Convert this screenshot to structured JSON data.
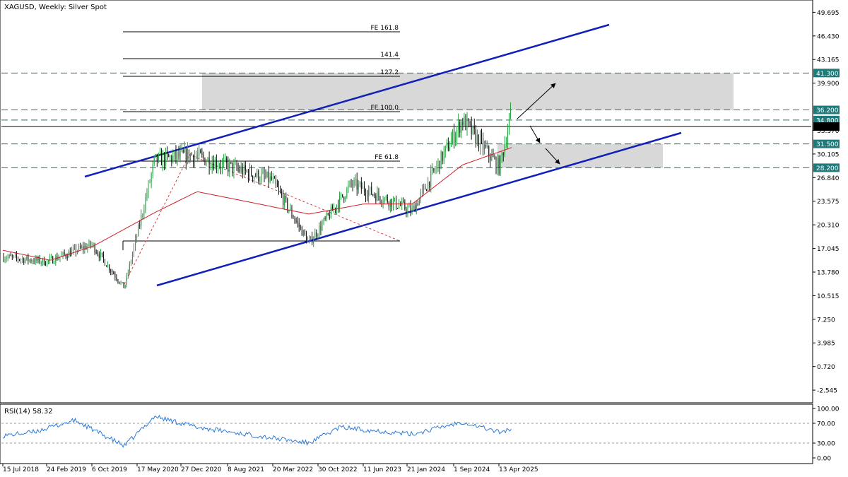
{
  "header": {
    "symbol_title": "XAGUSD, Weekly:  Silver Spot"
  },
  "rsi_panel": {
    "title": "RSI(14) 58.32",
    "value": 58.32,
    "levels": [
      70,
      30
    ],
    "axis_ticks": [
      "100.00",
      "70.00",
      "30.00",
      "0.00"
    ]
  },
  "price_axis_ticks": [
    "49.695",
    "46.430",
    "43.165",
    "39.900",
    "33.370",
    "30.105",
    "26.840",
    "23.575",
    "20.310",
    "17.045",
    "13.780",
    "10.515",
    "7.250",
    "3.985",
    "0.720",
    "-2.545"
  ],
  "time_axis_ticks": [
    "15 Jul 2018",
    "24 Feb 2019",
    "6 Oct 2019",
    "17 May 2020",
    "27 Dec 2020",
    "8 Aug 2021",
    "20 Mar 2022",
    "30 Oct 2022",
    "11 Jun 2023",
    "21 Jan 2024",
    "1 Sep 2024",
    "13 Apr 2025"
  ],
  "key_levels": [
    {
      "label": "41.300",
      "value": 41.3
    },
    {
      "label": "36.200",
      "value": 36.2
    },
    {
      "label": "34.800",
      "value": 34.8
    },
    {
      "label": "31.500",
      "value": 31.5
    },
    {
      "label": "28.200",
      "value": 28.2
    }
  ],
  "fibonacci_labels": [
    "FE 161.8",
    "141.4",
    "127.2",
    "FE 100.0",
    "FE 61.8"
  ],
  "colors": {
    "bull": "#26a041",
    "bear": "#111111",
    "ma": "#d0202a",
    "channel": "#1020b8",
    "level_line": "#1f6f78",
    "level_badge": "#1f7a7a",
    "zone": "#d8d8d8",
    "rsi_line": "#2b7bd6"
  },
  "chart_data": {
    "type": "candlestick",
    "title": "XAGUSD, Weekly:  Silver Spot",
    "ylim": [
      -4.1,
      51.2
    ],
    "key_points": [
      {
        "date": "15 Jul 2018",
        "price": 15.9
      },
      {
        "date": "24 Feb 2019",
        "price": 15.2
      },
      {
        "date": "6 Oct 2019",
        "price": 17.6
      },
      {
        "date": "Mar 2020",
        "price": 11.6
      },
      {
        "date": "Aug 2020",
        "price": 29.2
      },
      {
        "date": "Feb 2021",
        "price": 30.0
      },
      {
        "date": "Mar 2022",
        "price": 26.5
      },
      {
        "date": "Sep 2022",
        "price": 17.8
      },
      {
        "date": "Apr 2023",
        "price": 26.0
      },
      {
        "date": "Feb 2024",
        "price": 22.2
      },
      {
        "date": "Oct 2024",
        "price": 34.8
      },
      {
        "date": "Apr 2025",
        "price": 28.2
      },
      {
        "date": "Jun 2025",
        "price": 36.0
      }
    ],
    "moving_average_points": [
      {
        "date": "15 Jul 2018",
        "price": 16.8
      },
      {
        "date": "Mar 2019",
        "price": 15.4
      },
      {
        "date": "Oct 2019",
        "price": 17.4
      },
      {
        "date": "Aug 2020",
        "price": 22.0
      },
      {
        "date": "Mar 2021",
        "price": 24.9
      },
      {
        "date": "Sep 2022",
        "price": 21.8
      },
      {
        "date": "Jun 2023",
        "price": 23.2
      },
      {
        "date": "Feb 2024",
        "price": 23.2
      },
      {
        "date": "Oct 2024",
        "price": 28.6
      },
      {
        "date": "Jun 2025",
        "price": 31.0
      }
    ],
    "series": [
      {
        "values": [
          {
            "date": "15 Jul 2018",
            "value": 45
          },
          {
            "date": "Dec 2018",
            "value": 52
          },
          {
            "date": "Jul 2019",
            "value": 76
          },
          {
            "date": "Mar 2020",
            "value": 24
          },
          {
            "date": "Aug 2020",
            "value": 84
          },
          {
            "date": "Mar 2021",
            "value": 62
          },
          {
            "date": "Sep 2022",
            "value": 30
          },
          {
            "date": "Feb 2023",
            "value": 62
          },
          {
            "date": "Feb 2024",
            "value": 48
          },
          {
            "date": "Oct 2024",
            "value": 73
          },
          {
            "date": "Apr 2025",
            "value": 52
          },
          {
            "date": "Jun 2025",
            "value": 58.32
          }
        ]
      }
    ]
  }
}
